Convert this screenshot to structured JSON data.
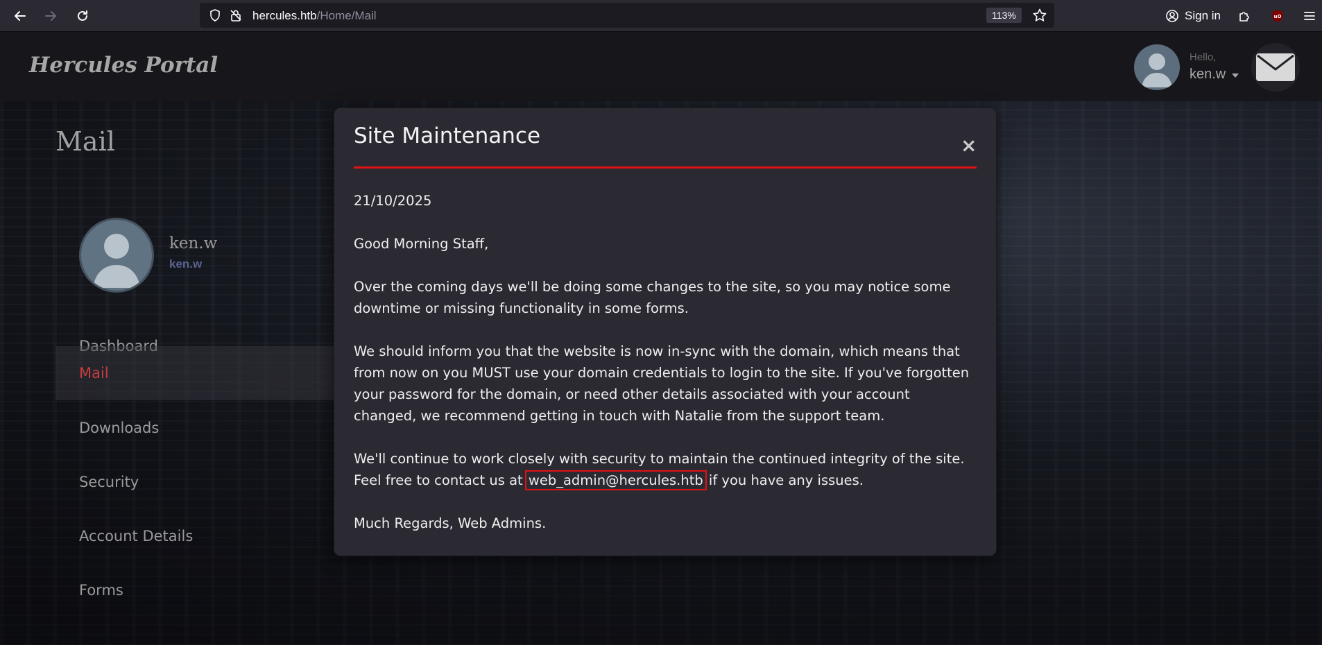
{
  "browser": {
    "url_host": "hercules.htb",
    "url_path": "/Home/Mail",
    "zoom": "113%",
    "sign_in_label": "Sign in"
  },
  "header": {
    "brand": "Hercules Portal",
    "greeting": "Hello,",
    "username": "ken.w"
  },
  "sidebar": {
    "page_title": "Mail",
    "profile_name": "ken.w",
    "profile_handle": "ken.w",
    "items": [
      {
        "label": "Dashboard"
      },
      {
        "label": "Mail"
      },
      {
        "label": "Downloads"
      },
      {
        "label": "Security"
      },
      {
        "label": "Account Details"
      },
      {
        "label": "Forms"
      }
    ],
    "active_item": "Mail"
  },
  "modal": {
    "title": "Site Maintenance",
    "close_symbol": "×",
    "date": "21/10/2025",
    "greeting": "Good Morning Staff,",
    "para1": "Over the coming days we'll be doing some changes to the site, so you may notice some downtime or missing functionality in some forms.",
    "para2": "We should inform you that the website is now in-sync with the domain, which means that from now on you MUST use your domain credentials to login to the site. If you've forgotten your password for the domain, or need other details associated with your account changed, we recommend getting in touch with Natalie from the support team.",
    "para3_before": "We'll continue to work closely with security to maintain the continued integrity of the site. Feel free to contact us at ",
    "para3_email": "web_admin@hercules.htb",
    "para3_after": " if you have any issues.",
    "signoff": "Much Regards, Web Admins."
  },
  "colors": {
    "accent_red": "#e01313",
    "active_nav": "#c63d3d",
    "modal_bg": "#2b2a33"
  }
}
